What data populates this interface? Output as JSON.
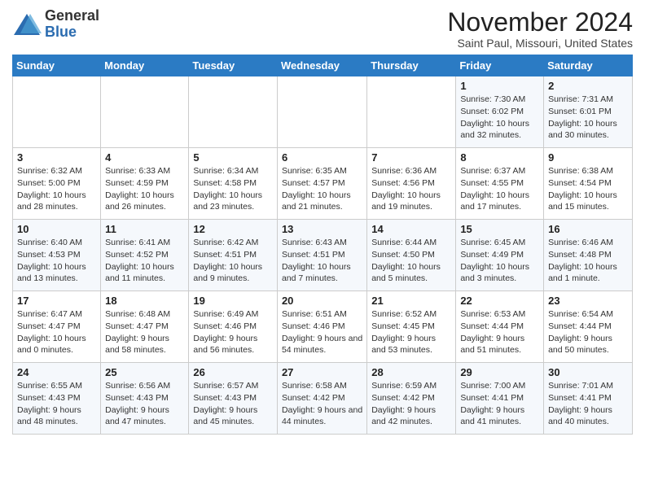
{
  "header": {
    "logo_line1": "General",
    "logo_line2": "Blue",
    "month": "November 2024",
    "location": "Saint Paul, Missouri, United States"
  },
  "days_of_week": [
    "Sunday",
    "Monday",
    "Tuesday",
    "Wednesday",
    "Thursday",
    "Friday",
    "Saturday"
  ],
  "weeks": [
    [
      {
        "day": "",
        "detail": ""
      },
      {
        "day": "",
        "detail": ""
      },
      {
        "day": "",
        "detail": ""
      },
      {
        "day": "",
        "detail": ""
      },
      {
        "day": "",
        "detail": ""
      },
      {
        "day": "1",
        "detail": "Sunrise: 7:30 AM\nSunset: 6:02 PM\nDaylight: 10 hours and 32 minutes."
      },
      {
        "day": "2",
        "detail": "Sunrise: 7:31 AM\nSunset: 6:01 PM\nDaylight: 10 hours and 30 minutes."
      }
    ],
    [
      {
        "day": "3",
        "detail": "Sunrise: 6:32 AM\nSunset: 5:00 PM\nDaylight: 10 hours and 28 minutes."
      },
      {
        "day": "4",
        "detail": "Sunrise: 6:33 AM\nSunset: 4:59 PM\nDaylight: 10 hours and 26 minutes."
      },
      {
        "day": "5",
        "detail": "Sunrise: 6:34 AM\nSunset: 4:58 PM\nDaylight: 10 hours and 23 minutes."
      },
      {
        "day": "6",
        "detail": "Sunrise: 6:35 AM\nSunset: 4:57 PM\nDaylight: 10 hours and 21 minutes."
      },
      {
        "day": "7",
        "detail": "Sunrise: 6:36 AM\nSunset: 4:56 PM\nDaylight: 10 hours and 19 minutes."
      },
      {
        "day": "8",
        "detail": "Sunrise: 6:37 AM\nSunset: 4:55 PM\nDaylight: 10 hours and 17 minutes."
      },
      {
        "day": "9",
        "detail": "Sunrise: 6:38 AM\nSunset: 4:54 PM\nDaylight: 10 hours and 15 minutes."
      }
    ],
    [
      {
        "day": "10",
        "detail": "Sunrise: 6:40 AM\nSunset: 4:53 PM\nDaylight: 10 hours and 13 minutes."
      },
      {
        "day": "11",
        "detail": "Sunrise: 6:41 AM\nSunset: 4:52 PM\nDaylight: 10 hours and 11 minutes."
      },
      {
        "day": "12",
        "detail": "Sunrise: 6:42 AM\nSunset: 4:51 PM\nDaylight: 10 hours and 9 minutes."
      },
      {
        "day": "13",
        "detail": "Sunrise: 6:43 AM\nSunset: 4:51 PM\nDaylight: 10 hours and 7 minutes."
      },
      {
        "day": "14",
        "detail": "Sunrise: 6:44 AM\nSunset: 4:50 PM\nDaylight: 10 hours and 5 minutes."
      },
      {
        "day": "15",
        "detail": "Sunrise: 6:45 AM\nSunset: 4:49 PM\nDaylight: 10 hours and 3 minutes."
      },
      {
        "day": "16",
        "detail": "Sunrise: 6:46 AM\nSunset: 4:48 PM\nDaylight: 10 hours and 1 minute."
      }
    ],
    [
      {
        "day": "17",
        "detail": "Sunrise: 6:47 AM\nSunset: 4:47 PM\nDaylight: 10 hours and 0 minutes."
      },
      {
        "day": "18",
        "detail": "Sunrise: 6:48 AM\nSunset: 4:47 PM\nDaylight: 9 hours and 58 minutes."
      },
      {
        "day": "19",
        "detail": "Sunrise: 6:49 AM\nSunset: 4:46 PM\nDaylight: 9 hours and 56 minutes."
      },
      {
        "day": "20",
        "detail": "Sunrise: 6:51 AM\nSunset: 4:46 PM\nDaylight: 9 hours and 54 minutes."
      },
      {
        "day": "21",
        "detail": "Sunrise: 6:52 AM\nSunset: 4:45 PM\nDaylight: 9 hours and 53 minutes."
      },
      {
        "day": "22",
        "detail": "Sunrise: 6:53 AM\nSunset: 4:44 PM\nDaylight: 9 hours and 51 minutes."
      },
      {
        "day": "23",
        "detail": "Sunrise: 6:54 AM\nSunset: 4:44 PM\nDaylight: 9 hours and 50 minutes."
      }
    ],
    [
      {
        "day": "24",
        "detail": "Sunrise: 6:55 AM\nSunset: 4:43 PM\nDaylight: 9 hours and 48 minutes."
      },
      {
        "day": "25",
        "detail": "Sunrise: 6:56 AM\nSunset: 4:43 PM\nDaylight: 9 hours and 47 minutes."
      },
      {
        "day": "26",
        "detail": "Sunrise: 6:57 AM\nSunset: 4:43 PM\nDaylight: 9 hours and 45 minutes."
      },
      {
        "day": "27",
        "detail": "Sunrise: 6:58 AM\nSunset: 4:42 PM\nDaylight: 9 hours and 44 minutes."
      },
      {
        "day": "28",
        "detail": "Sunrise: 6:59 AM\nSunset: 4:42 PM\nDaylight: 9 hours and 42 minutes."
      },
      {
        "day": "29",
        "detail": "Sunrise: 7:00 AM\nSunset: 4:41 PM\nDaylight: 9 hours and 41 minutes."
      },
      {
        "day": "30",
        "detail": "Sunrise: 7:01 AM\nSunset: 4:41 PM\nDaylight: 9 hours and 40 minutes."
      }
    ]
  ]
}
